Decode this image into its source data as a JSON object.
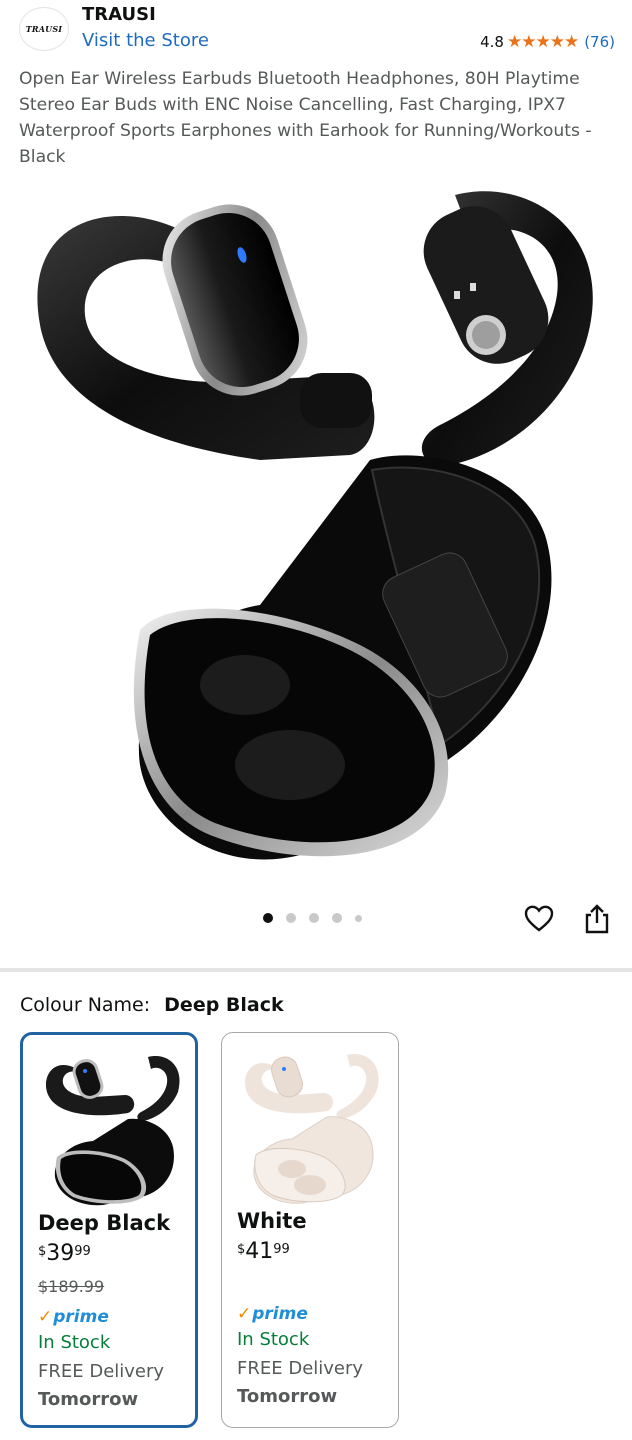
{
  "store": {
    "logo_text": "TRAUSI",
    "name": "TRAUSI",
    "link_label": "Visit the Store"
  },
  "rating": {
    "value": "4.8",
    "stars": 4.8,
    "count": "(76)"
  },
  "product": {
    "title": "Open Ear Wireless Earbuds Bluetooth Headphones, 80H Playtime Stereo Ear Buds with ENC Noise Cancelling, Fast Charging, IPX7 Waterproof Sports Earphones with Earhook for Running/Workouts - Black"
  },
  "carousel": {
    "total_images": 5,
    "active_index": 0
  },
  "colour": {
    "label": "Colour Name:",
    "selected": "Deep Black"
  },
  "swatches": [
    {
      "name": "Deep Black",
      "price_symbol": "$",
      "price_whole": "39",
      "price_fraction": "99",
      "was_price": "$189.99",
      "prime": "prime",
      "stock": "In Stock",
      "delivery": "FREE Delivery",
      "delivery_day": "Tomorrow"
    },
    {
      "name": "White",
      "price_symbol": "$",
      "price_whole": "41",
      "price_fraction": "99",
      "prime": "prime",
      "stock": "In Stock",
      "delivery": "FREE Delivery",
      "delivery_day": "Tomorrow"
    }
  ],
  "colors": {
    "link": "#1f6bbf",
    "star": "#e8731b",
    "selected_border": "#2162a1",
    "in_stock": "#067d3a",
    "prime": "#1f8ed6"
  }
}
